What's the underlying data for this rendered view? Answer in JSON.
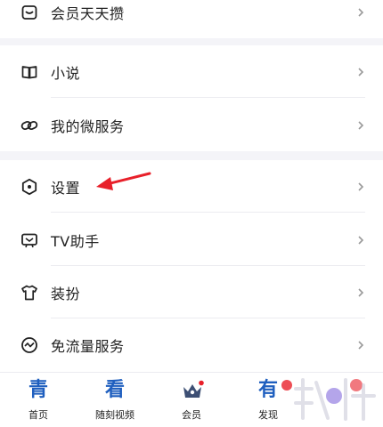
{
  "menu": {
    "items": [
      {
        "label": "会员天天攒",
        "icon": "wallet-icon"
      },
      {
        "label": "小说",
        "icon": "book-icon"
      },
      {
        "label": "我的微服务",
        "icon": "link-icon"
      },
      {
        "label": "设置",
        "icon": "settings-hexagon-icon"
      },
      {
        "label": "TV助手",
        "icon": "tv-icon"
      },
      {
        "label": "装扮",
        "icon": "tshirt-icon"
      },
      {
        "label": "免流量服务",
        "icon": "traffic-wave-icon"
      }
    ]
  },
  "tabbar": {
    "tabs": [
      {
        "glyph": "青",
        "label": "首页"
      },
      {
        "glyph": "看",
        "label": "随刻视频"
      },
      {
        "glyph": "",
        "label": "会员"
      },
      {
        "glyph": "有",
        "label": "发现"
      },
      {
        "glyph": "",
        "label": ""
      }
    ]
  },
  "colors": {
    "accent": "#1f5fbf",
    "annotation_arrow": "#e8202a",
    "background": "#f4f4f8"
  }
}
